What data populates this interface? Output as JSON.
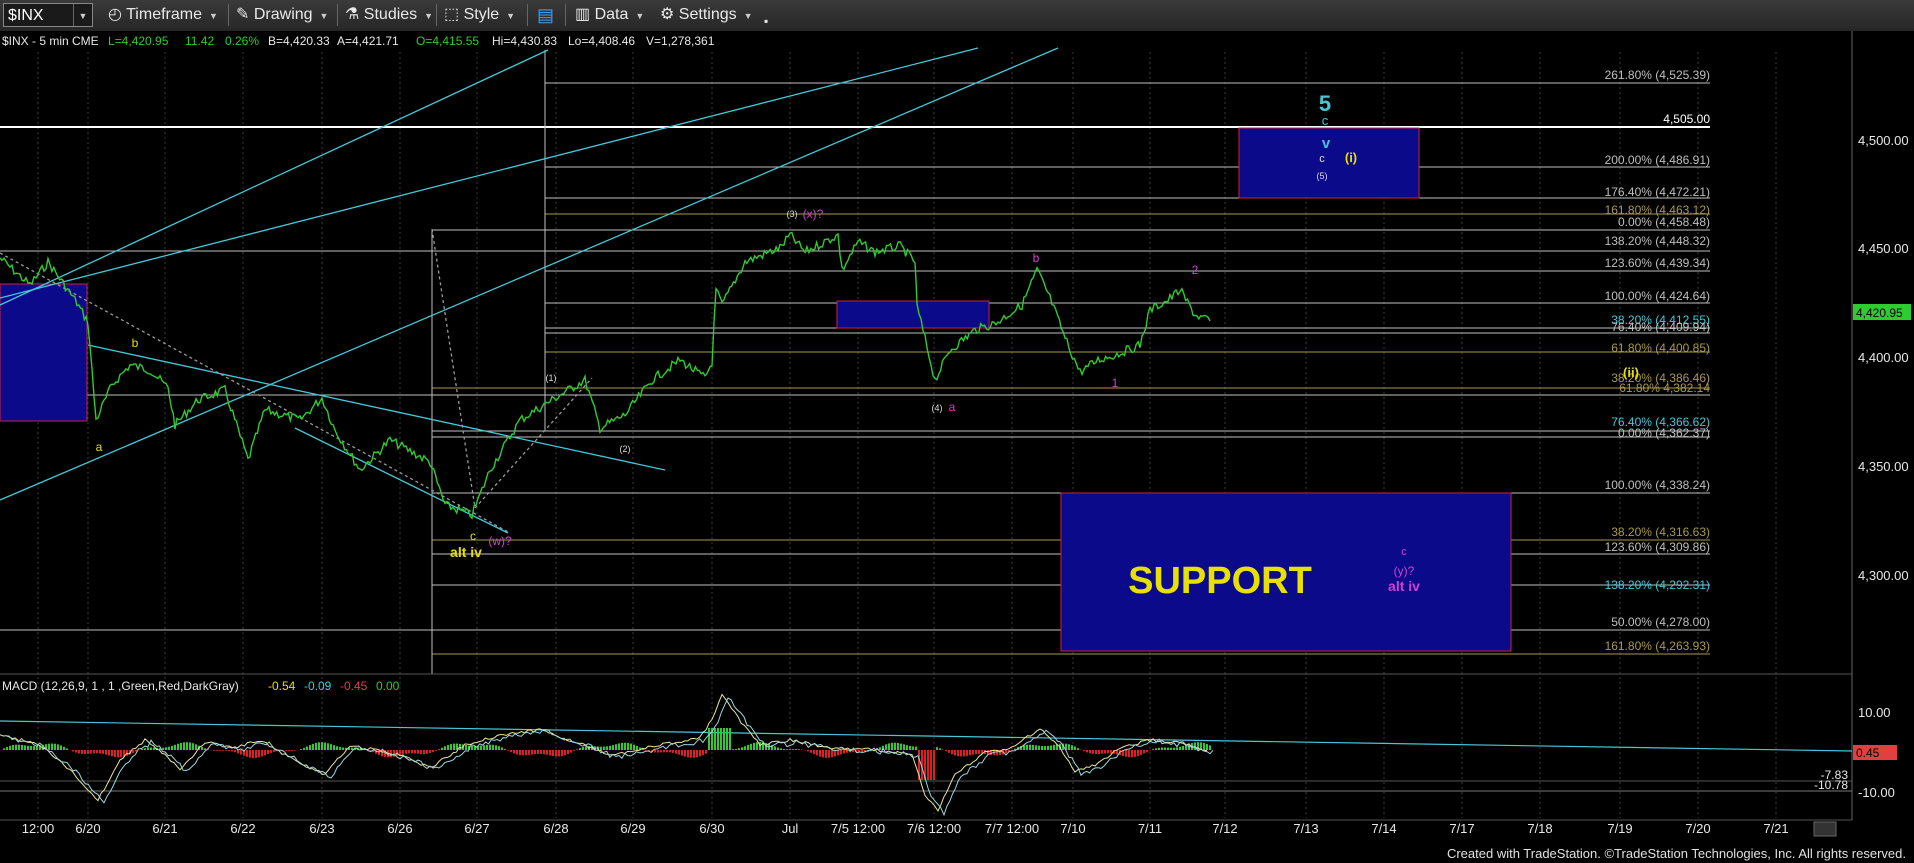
{
  "toolbar": {
    "symbol": "$INX",
    "timeframe": "Timeframe",
    "drawing": "Drawing",
    "studies": "Studies",
    "style": "Style",
    "data": "Data",
    "settings": "Settings"
  },
  "header": {
    "symbol_line": "$INX - 5 min  CME",
    "last": "L=4,420.95",
    "change": "11.42",
    "change_pct": "0.26%",
    "bid": "B=4,420.33",
    "ask": "A=4,421.71",
    "open": "O=4,415.55",
    "high": "Hi=4,430.83",
    "low": "Lo=4,408.46",
    "volume": "V=1,278,361"
  },
  "price_axis": {
    "ticks": [
      "4,500.00",
      "4,450.00",
      "4,400.00",
      "4,350.00",
      "4,300.00"
    ],
    "last_price_tag": "4,420.95",
    "macd_ticks": [
      "10.00",
      "-10.00"
    ],
    "macd_tags": [
      "0.45",
      "-7.83",
      "-10.78"
    ]
  },
  "time_axis": [
    "12:00",
    "6/20",
    "6/21",
    "6/22",
    "6/23",
    "6/26",
    "6/27",
    "6/28",
    "6/29",
    "6/30",
    "Jul",
    "7/5 12:00",
    "7/6 12:00",
    "7/7 12:00",
    "7/10",
    "7/11",
    "7/12",
    "7/13",
    "7/14",
    "7/17",
    "7/18",
    "7/19",
    "7/20",
    "7/21"
  ],
  "fib_labels": [
    "261.80% (4,525.39)",
    "4,505.00",
    "200.00% (4,486.91)",
    "176.40% (4,472.21)",
    "161.80% (4,463.12)",
    "0.00% (4,458.48)",
    "138.20% (4,448.32)",
    "123.60% (4,439.34)",
    "100.00% (4,424.64)",
    "38.20% (4,412.55)",
    "76.40% (4,409.94)",
    "61.80% (4,400.85)",
    "38.20% (4,386.46)",
    "61.80% 4,382.14",
    "76.40% (4,366.62)",
    "0.00% (4,362.37)",
    "100.00% (4,338.24)",
    "38.20% (4,316.63)",
    "123.60% (4,309.86)",
    "138.20% (4,292.31)",
    "50.00% (4,278.00)",
    "161.80% (4,263.93)"
  ],
  "wave_labels": {
    "w5": "5",
    "w5c": "c",
    "v": "v",
    "c5": "c",
    "five": "(5)",
    "i": "(i)",
    "x3": "(3)",
    "xq": "(x)?",
    "b_top": "b",
    "two": "2",
    "four": "(4)",
    "a_low": "a",
    "one": "1",
    "ii": "(ii)",
    "b_left": "b",
    "a_left": "a",
    "one_p": "(1)",
    "two_p": "(2)",
    "c_low": "c",
    "wq": "(w)?",
    "alt_iv_y": "alt iv",
    "c_sup": "c",
    "yq": "(y)?",
    "alt_iv_m": "alt iv"
  },
  "support_label": "SUPPORT",
  "macd_label": {
    "title": "MACD (12,26,9, 1 , 1 ,Green,Red,DarkGray)",
    "v1": "-0.54",
    "v2": "-0.09",
    "v3": "-0.45",
    "v4": "0.00"
  },
  "footer": "Created with TradeStation. ©TradeStation Technologies, Inc. All rights reserved.",
  "colors": {
    "price": "#2ecc2e",
    "channel": "#44c8d8",
    "fib": "#bfbfbf",
    "gold": "#a89a48",
    "magenta": "#d040d0",
    "yellow": "#e8e000",
    "box_fill": "#0a0a8a",
    "box_edge": "#d02040"
  }
}
